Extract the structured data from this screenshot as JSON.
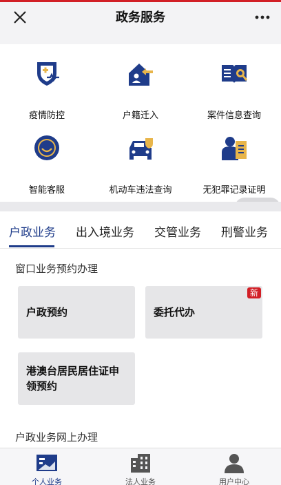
{
  "header": {
    "title": "政务服务"
  },
  "services": [
    {
      "label": "疫情防控",
      "icon": "shield-plus-icon"
    },
    {
      "label": "户籍迁入",
      "icon": "house-arrow-icon"
    },
    {
      "label": "案件信息查询",
      "icon": "book-search-icon"
    },
    {
      "label": "智能客服",
      "icon": "smile-gear-icon"
    },
    {
      "label": "机动车违法查询",
      "icon": "car-shield-icon"
    },
    {
      "label": "无犯罪记录证明",
      "icon": "person-certificate-icon"
    }
  ],
  "tabs": [
    {
      "label": "户政业务",
      "active": true
    },
    {
      "label": "出入境业务",
      "active": false
    },
    {
      "label": "交管业务",
      "active": false
    },
    {
      "label": "刑警业务",
      "active": false
    }
  ],
  "section1": {
    "title": "窗口业务预约办理",
    "cards": [
      {
        "label": "户政预约"
      },
      {
        "label": "委托代办",
        "badge": "新"
      },
      {
        "label": "港澳台居民居住证申领预约"
      }
    ]
  },
  "section2": {
    "title": "户政业务网上办理"
  },
  "bottom_nav": [
    {
      "label": "个人业务",
      "icon": "id-card-icon",
      "active": true
    },
    {
      "label": "法人业务",
      "icon": "building-icon",
      "active": false
    },
    {
      "label": "用户中心",
      "icon": "user-icon",
      "active": false
    }
  ],
  "colors": {
    "brand": "#1f3c8a",
    "accent": "#e8b54a",
    "badge": "#d21f26"
  }
}
